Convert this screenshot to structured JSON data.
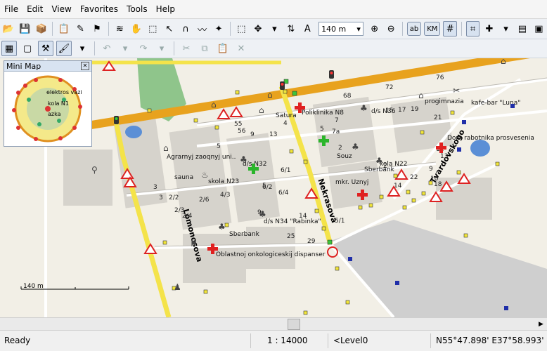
{
  "menu": [
    "File",
    "Edit",
    "View",
    "Favorites",
    "Tools",
    "Help"
  ],
  "toolbar": {
    "zoom_value": "140 m",
    "ab_label": "ab",
    "km_label": "KM"
  },
  "mini_map": {
    "title": "Mini Map",
    "close_label": "✕",
    "labels": [
      "elektros vazi",
      "kola N1",
      "azka"
    ]
  },
  "map": {
    "streets": {
      "nekrasova": "Nekrasova",
      "lomonosova": "Lomonosova",
      "tvardovskogo": "Tvardovskogo"
    },
    "scale_label": "140 m",
    "labels": [
      "Agrarnyj zaoqnyj uni..",
      "sauna",
      "skola N23",
      "Satura",
      "Poliklinika N8",
      "d/s N36",
      "progimnazia",
      "kafe-bar \"Luna\"",
      "Dom rabotnika prosvesenia",
      "d/s N32",
      "Souz",
      "kola N22",
      "Sberbank",
      "Sberbank",
      "mkr. Uznyj",
      "d/s N34 \"Rabinka\"",
      "Oblastnoj onkologiceskij dispanser"
    ],
    "house_numbers": [
      "76",
      "72",
      "68",
      "55",
      "56",
      "9",
      "13",
      "4",
      "5",
      "7",
      "7a",
      "2",
      "2",
      "15",
      "17",
      "19",
      "21",
      "3",
      "5",
      "6/1",
      "5",
      "9",
      "10",
      "11",
      "13",
      "14",
      "18",
      "3",
      "2/2",
      "2/6",
      "4/3",
      "6/2",
      "6/4",
      "2/3",
      "2/4",
      "9",
      "14",
      "25",
      "29",
      "5/1",
      "22"
    ]
  },
  "status": {
    "ready": "Ready",
    "scale": "1 : 14000",
    "level": "<Level0",
    "coords": "N55°47.898' E37°58.993'"
  }
}
